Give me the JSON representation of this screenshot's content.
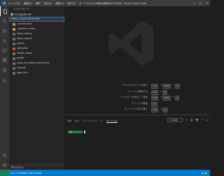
{
  "titlebar": {
    "menus": [
      "ファイル(F)",
      "編集(E)",
      "選択",
      "表示(V)",
      "移動(G)",
      "実行(R)",
      "ターミナル(T)",
      "ヘルプ(H)"
    ],
    "window_title": "MWG_Classifier-M-WW - Visual Studio Code",
    "controls": [
      "—",
      "▢",
      "✕"
    ]
  },
  "sidebar": {
    "header": "エクスプローラー",
    "header_more": "···",
    "section": "開いているエディター",
    "folder": "MWG_CLASSIFIER-M-WW",
    "items": [
      {
        "label": ".vscode.yaml",
        "icon": "folder-icon",
        "color": "#c09553"
      },
      {
        "label": "_episode_server",
        "icon": "folder-icon",
        "color": "#c09553"
      },
      {
        "label": "lower_history",
        "icon": "folder-icon",
        "color": "#6b6b6b"
      },
      {
        "label": "lower_logout",
        "icon": "folder-icon",
        "color": "#6b6b6b"
      },
      {
        "label": "lowers",
        "icon": "folder-icon",
        "color": "#6b6b6b"
      },
      {
        "label": ".gitconfig",
        "icon": "git-icon",
        "color": "#e44d26"
      },
      {
        "label": "model_elearn",
        "icon": "file-icon",
        "color": "#6b6b6b"
      },
      {
        "label": "profile",
        "icon": "file-icon",
        "color": "#6b6b6b"
      },
      {
        "label": "audio_as_written_successful",
        "icon": "file-icon",
        "color": "#6b6b6b"
      },
      {
        "label": "console",
        "icon": "file-icon",
        "color": "#6b6b6b"
      },
      {
        "label": "agen.hits",
        "icon": "file-icon",
        "color": "#6b6b6b"
      }
    ],
    "footer": "アウトライン"
  },
  "shortcuts": [
    {
      "label": "すべてのコマンドの表示",
      "keys": [
        "Ctrl",
        "Shift",
        "P"
      ]
    },
    {
      "label": "ファイルに移動する",
      "keys": [
        "Ctrl",
        "P"
      ]
    },
    {
      "label": "フォルダーを指定して検索",
      "keys": [
        "Ctrl",
        "Shift",
        "F"
      ]
    },
    {
      "label": "デバッグの開始",
      "keys": [
        "F5"
      ]
    },
    {
      "label": "ターミナルの切り替え",
      "keys": [
        "Ctrl",
        "@"
      ]
    }
  ],
  "panel": {
    "tabs": [
      "問題",
      "出力",
      "デバッグ コンソール",
      "ターミナル"
    ],
    "active_tab": 3,
    "terminal_select": "1: bash",
    "tools": [
      "+",
      "▥",
      "🗑",
      "^",
      "✕"
    ],
    "prompt": "~/$"
  },
  "statusbar": {
    "left": "⊗ 0  ⚠ 0  Python 3.6.9 64-bit",
    "right": "☺  🔔"
  },
  "colors": {
    "accent": "#007acc",
    "activity_bar": "#333333",
    "sidebar": "#252526",
    "editor": "#1e1e1e"
  }
}
